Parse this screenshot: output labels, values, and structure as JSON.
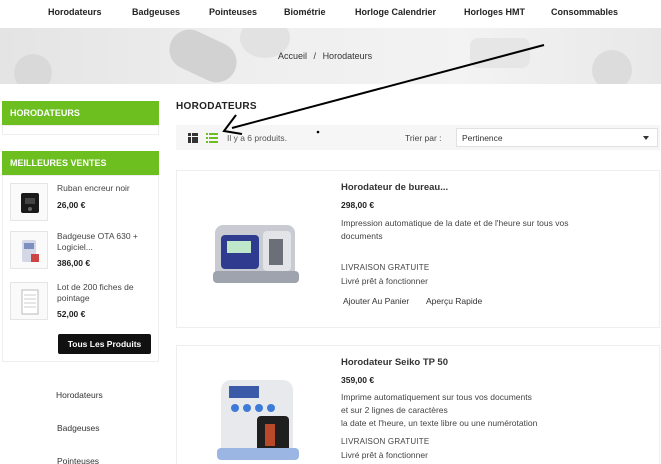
{
  "nav": {
    "items": [
      "Horodateurs",
      "Badgeuses",
      "Pointeuses",
      "Biométrie",
      "Horloge Calendrier",
      "Horloges HMT",
      "Consommables"
    ]
  },
  "breadcrumb": {
    "home": "Accueil",
    "separator": "/",
    "current": "Horodateurs"
  },
  "sidebar": {
    "category_heading": "HORODATEURS",
    "bestsellers_heading": "MEILLEURES VENTES",
    "bestsellers": [
      {
        "name": "Ruban encreur noir",
        "price": "26,00 €"
      },
      {
        "name": "Badgeuse OTA 630 + Logiciel...",
        "price": "386,00 €"
      },
      {
        "name": "Lot de 200 fiches de pointage",
        "price": "52,00 €"
      }
    ],
    "all_products_label": "Tous Les Produits",
    "categories": [
      "Horodateurs",
      "Badgeuses",
      "Pointeuses"
    ]
  },
  "main": {
    "title": "HORODATEURS",
    "product_count": "Il y a 6 produits.",
    "sort_label": "Trier par :",
    "sort_value": "Pertinence"
  },
  "products": [
    {
      "title": "Horodateur de bureau...",
      "price": "298,00 €",
      "desc1": "Impression automatique de la date et de l'heure sur tous vos",
      "desc2": "documents",
      "desc3": "",
      "shipping": "LIVRAISON GRATUITE",
      "ready": "Livré prêt à fonctionner",
      "add_to_cart": "Ajouter Au Panier",
      "quick_view": "Aperçu Rapide"
    },
    {
      "title": "Horodateur Seiko TP 50",
      "price": "359,00 €",
      "desc1": "Imprime automatiquement sur tous vos documents",
      "desc2": "et sur 2 lignes de caractères",
      "desc3": "la date et l'heure, un texte libre ou une numérotation",
      "shipping": "LIVRAISON GRATUITE",
      "ready": "Livré prêt à fonctionner"
    }
  ],
  "colors": {
    "accent_green": "#6cbf1f",
    "button_dark": "#111111",
    "arrow": "#000000"
  },
  "icons": {
    "grid_view": "grid-view-icon",
    "list_view": "list-view-icon",
    "sort_caret": "chevron-down-icon"
  }
}
